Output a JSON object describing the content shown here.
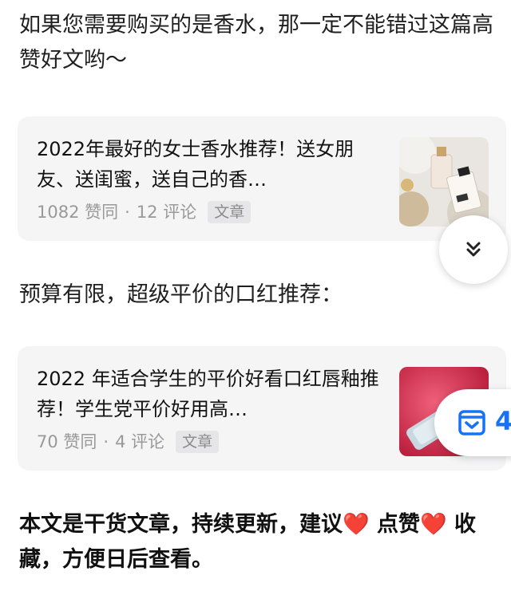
{
  "intro_text": "如果您需要购买的是香水，那一定不能错过这篇高赞好文哟～",
  "cards": [
    {
      "title": "2022年最好的女士香水推荐！送女朋友、送闺蜜，送自己的香…",
      "likes": "1082 赞同",
      "separator": "·",
      "comments": "12 评论",
      "tag": "文章"
    },
    {
      "title": "2022 年适合学生的平价好看口红唇釉推荐！学生党平价好用高…",
      "likes": "70 赞同",
      "separator": "·",
      "comments": "4 评论",
      "tag": "文章"
    }
  ],
  "section_text": "预算有限，超级平价的口红推荐：",
  "closing_text": "本文是干货文章，持续更新，建议❤️ 点赞❤️ 收藏，方便日后查看。",
  "collect_button": {
    "count": "4"
  },
  "icons": {
    "expand": "double-chevron-down-icon",
    "collect": "collect-box-icon"
  },
  "colors": {
    "accent": "#1772f6",
    "card_bg": "#f5f5f6",
    "meta": "#999999"
  }
}
